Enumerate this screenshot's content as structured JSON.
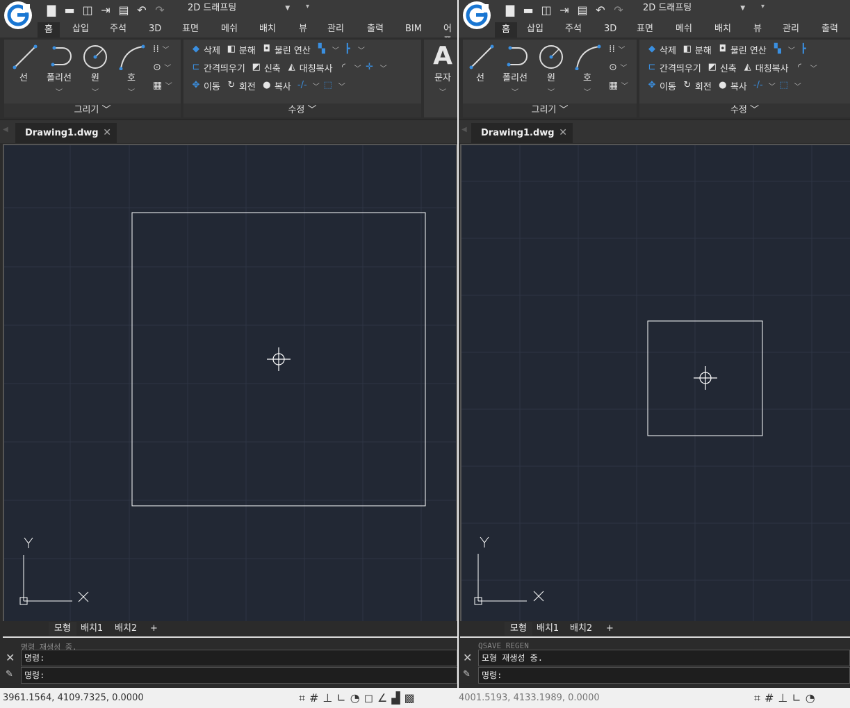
{
  "left": {
    "workspace": "2D 드래프팅",
    "tabs": [
      "홈",
      "삽입",
      "주석",
      "3D",
      "표면",
      "메쉬",
      "배치",
      "뷰",
      "관리",
      "출력",
      "BIM",
      "어플"
    ],
    "draw_tools": [
      "선",
      "폴리선",
      "원",
      "호"
    ],
    "draw_panel_title": "그리기",
    "modify_rows": [
      [
        "삭제",
        "분해",
        "불린 연산"
      ],
      [
        "간격띄우기",
        "신축",
        "대칭복사"
      ],
      [
        "이동",
        "회전",
        "복사"
      ]
    ],
    "modify_panel_title": "수정",
    "text_tool": "문자",
    "document_tab": "Drawing1.dwg",
    "layout_tabs": [
      "모형",
      "배치1",
      "배치2",
      "+"
    ],
    "command_history": "명령 재생성 중.",
    "command_line1": "명령:",
    "command_line2": "명령:",
    "coords": "3961.1564, 4109.7325, 0.0000"
  },
  "right": {
    "workspace": "2D 드래프팅",
    "tabs": [
      "홈",
      "삽입",
      "주석",
      "3D",
      "표면",
      "메쉬",
      "배치",
      "뷰",
      "관리",
      "출력"
    ],
    "draw_tools": [
      "선",
      "폴리선",
      "원",
      "호"
    ],
    "draw_panel_title": "그리기",
    "modify_rows": [
      [
        "삭제",
        "분해",
        "불린 연산"
      ],
      [
        "간격띄우기",
        "신축",
        "대칭복사"
      ],
      [
        "이동",
        "회전",
        "복사"
      ]
    ],
    "modify_panel_title": "수정",
    "document_tab": "Drawing1.dwg",
    "layout_tabs": [
      "모형",
      "배치1",
      "배치2",
      "+"
    ],
    "command_history": "QSAVE REGEN",
    "command_line1": "모형 재생성 중.",
    "command_line2": "명령:",
    "coords": "4001.5193, 4133.1989, 0.0000"
  },
  "colors": {
    "canvas_bg": "#222834",
    "grid": "#2e3544",
    "ribbon_bg": "#3b3b3b",
    "accent_blue": "#3a8fe0",
    "logo_blue": "#1976d2"
  }
}
